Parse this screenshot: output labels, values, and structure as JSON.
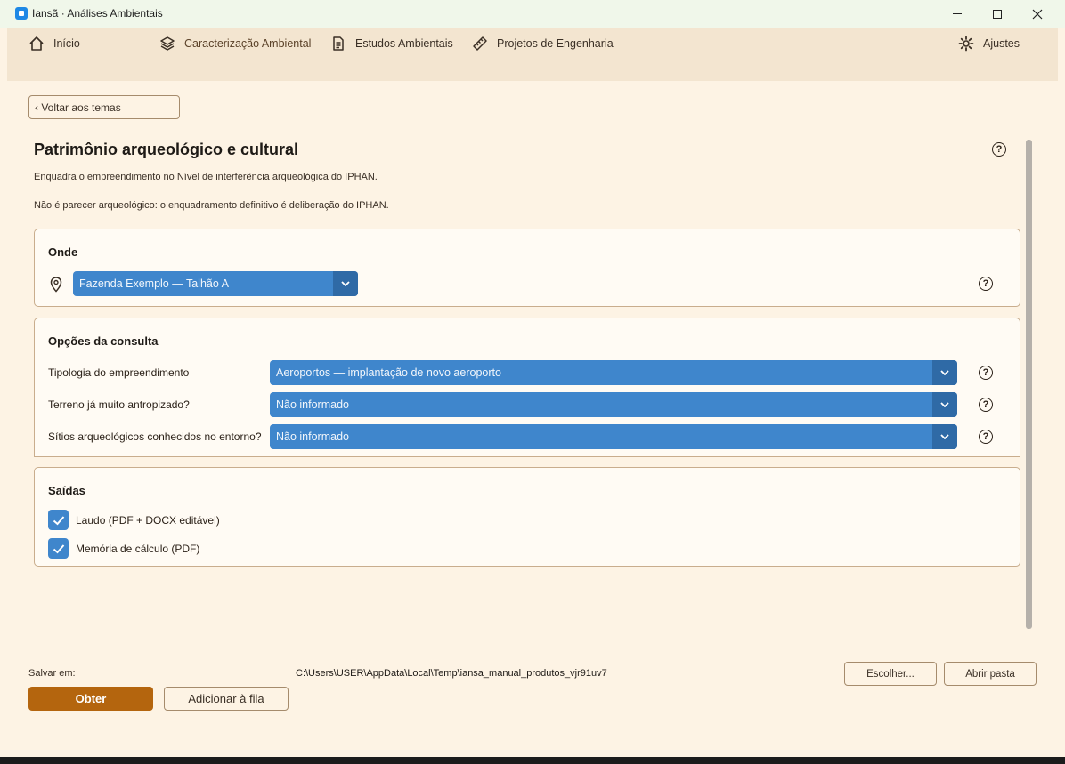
{
  "window": {
    "title": "Iansã · Análises Ambientais",
    "minimize_icon": "minimize-icon",
    "maximize_icon": "maximize-icon",
    "close_icon": "close-icon"
  },
  "nav": {
    "items": [
      {
        "label": "Início",
        "icon": "home-icon"
      },
      {
        "label": "Caracterização Ambiental",
        "icon": "layers-icon"
      },
      {
        "label": "Estudos Ambientais",
        "icon": "document-icon"
      },
      {
        "label": "Projetos de Engenharia",
        "icon": "ruler-icon"
      },
      {
        "label": "Ajustes",
        "icon": "gear-icon"
      }
    ]
  },
  "back_button": "‹ Voltar aos temas",
  "page": {
    "title": "Patrimônio arqueológico e cultural",
    "description_1": "Enquadra o empreendimento no Nível de interferência arqueológica do IPHAN.",
    "description_2": "Não é parecer arqueológico: o enquadramento definitivo é deliberação do IPHAN.",
    "help_symbol": "?"
  },
  "onde": {
    "title": "Onde",
    "location_icon": "map-pin-icon",
    "selected": "Fazenda Exemplo — Talhão A"
  },
  "opcoes": {
    "title": "Opções da consulta",
    "rows": [
      {
        "label": "Tipologia do empreendimento",
        "value": "Aeroportos — implantação de novo aeroporto"
      },
      {
        "label": "Terreno já muito antropizado?",
        "value": "Não informado"
      },
      {
        "label": "Sítios arqueológicos conhecidos no entorno?",
        "value": "Não informado"
      }
    ]
  },
  "saidas": {
    "title": "Saídas",
    "items": [
      {
        "label": "Laudo (PDF + DOCX editável)",
        "checked": true
      },
      {
        "label": "Memória de cálculo (PDF)",
        "checked": true
      }
    ]
  },
  "footer": {
    "save_label": "Salvar em:",
    "save_path": "C:\\Users\\USER\\AppData\\Local\\Temp\\iansa_manual_produtos_vjr91uv7",
    "choose_button": "Escolher...",
    "open_folder_button": "Abrir pasta",
    "obtain_button": "Obter",
    "queue_button": "Adicionar à fila"
  },
  "colors": {
    "accent": "#b4650e",
    "select_blue": "#3f86cc",
    "background": "#fdf3e4"
  }
}
